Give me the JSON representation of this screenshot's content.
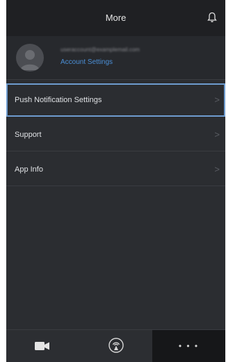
{
  "header": {
    "title": "More",
    "bell_icon": "bell-icon"
  },
  "profile": {
    "email": "useraccount@examplemail.com",
    "account_link": "Account Settings",
    "avatar_icon": "avatar-icon"
  },
  "menu": {
    "items": [
      {
        "label": "Push Notification Settings",
        "chevron": ">"
      },
      {
        "label": "Support",
        "chevron": ">"
      },
      {
        "label": "App Info",
        "chevron": ">"
      }
    ]
  },
  "tabbar": {
    "tabs": [
      {
        "icon": "video-camera-icon"
      },
      {
        "icon": "broadcast-icon"
      },
      {
        "icon": "more-icon",
        "label": "• • •",
        "active": true
      }
    ]
  },
  "colors": {
    "background": "#2b2d31",
    "header": "#1f2023",
    "accent": "#4b8fd6",
    "selection": "#6e9ccf"
  }
}
